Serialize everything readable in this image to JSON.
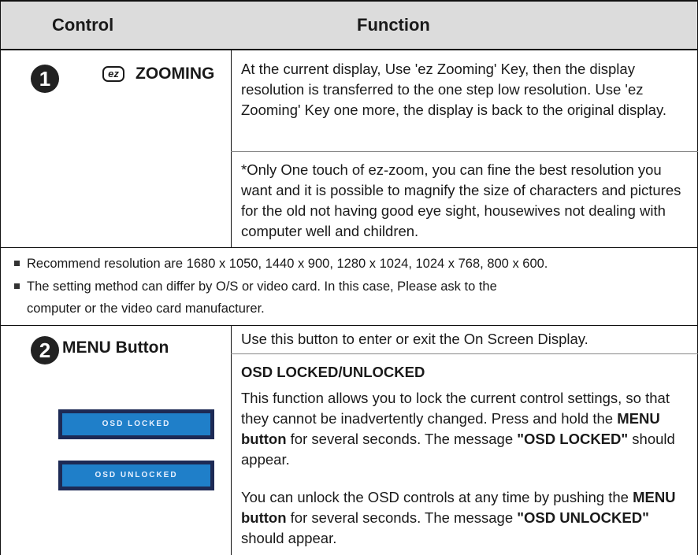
{
  "header": {
    "control": "Control",
    "function": "Function"
  },
  "section1": {
    "number": "1",
    "icon_text": "ez",
    "control": "ZOOMING",
    "para1": "At the current display, Use 'ez Zooming' Key, then the display resolution is transferred to the one step low resolution. Use 'ez Zooming' Key one more, the display is back to the original display.",
    "para2": "*Only One touch of ez-zoom, you can fine the best resolution you want and it is possible to magnify the size of characters and pictures for the old not having good eye sight, housewives not dealing with computer well and children."
  },
  "notes": [
    "Recommend resolution are 1680 x 1050, 1440 x 900, 1280 x 1024, 1024 x 768, 800 x 600.",
    "The setting method can differ by O/S or video card. In this case, Please ask to the",
    "computer or the video card manufacturer."
  ],
  "section2": {
    "number": "2",
    "control": "MENU Button",
    "intro": "Use this button to enter or exit the On Screen Display.",
    "subheading": "OSD LOCKED/UNLOCKED",
    "p1_a": "This function allows you to lock the current control settings, so that they cannot be inadvertently changed. Press and hold the ",
    "p1_b": "MENU button",
    "p1_c": " for several seconds. The message ",
    "p1_d": "\"OSD LOCKED\"",
    "p1_e": " should appear.",
    "p2_a": "You can unlock the OSD controls at any time by pushing the ",
    "p2_b": "MENU button",
    "p2_c": " for several seconds. The message ",
    "p2_d": "\"OSD UNLOCKED\"",
    "p2_e": " should appear.",
    "osd_locked": "OSD LOCKED",
    "osd_unlocked": "OSD UNLOCKED"
  }
}
